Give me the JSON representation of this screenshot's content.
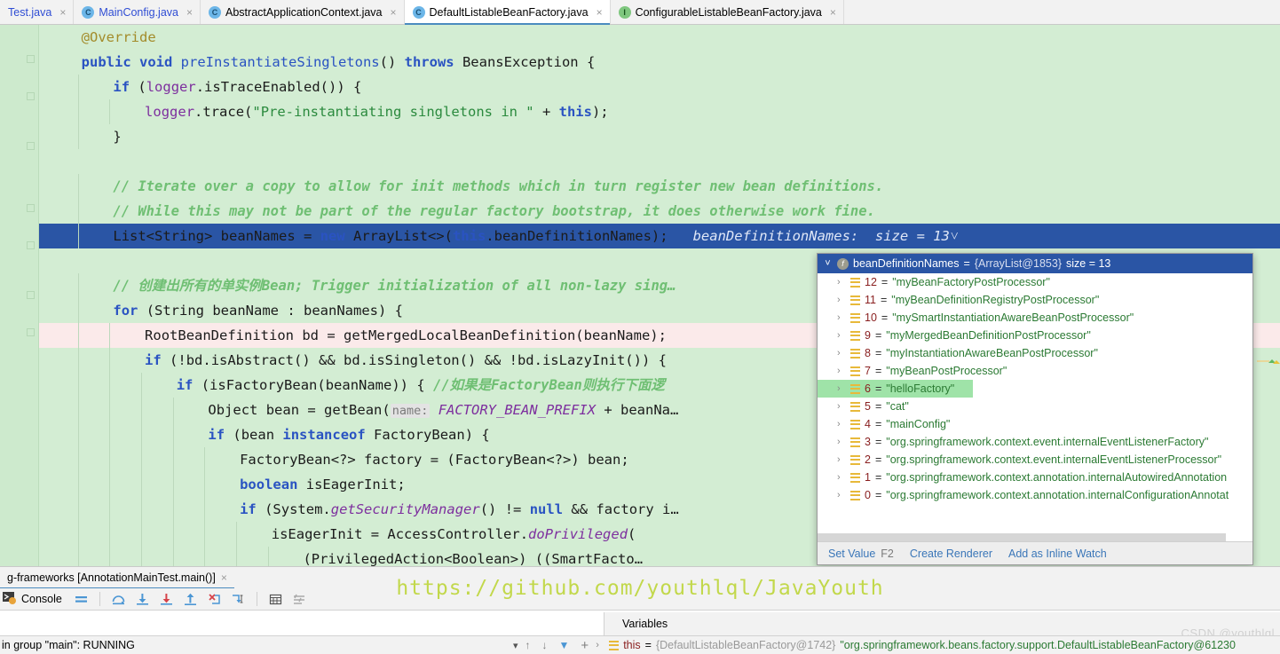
{
  "tabs": [
    {
      "label": "Test.java",
      "icon": "none",
      "active": false,
      "colored": true,
      "close": "×"
    },
    {
      "label": "MainConfig.java",
      "icon": "class-c",
      "active": false,
      "colored": true,
      "close": "×"
    },
    {
      "label": "AbstractApplicationContext.java",
      "icon": "class-c",
      "active": false,
      "colored": false,
      "close": "×"
    },
    {
      "label": "DefaultListableBeanFactory.java",
      "icon": "class-c",
      "active": true,
      "colored": false,
      "close": "×"
    },
    {
      "label": "ConfigurableListableBeanFactory.java",
      "icon": "interface-i",
      "active": false,
      "colored": false,
      "close": "×"
    }
  ],
  "editor": {
    "background": "#d3edd3",
    "highlight_line_color": "#2a55a5",
    "inline_watch": "beanDefinitionNames:  size = 13",
    "inline_watch_chevron": "˅",
    "lines": [
      {
        "tokens": [
          {
            "t": "@Override",
            "c": "ann"
          }
        ],
        "indent": 1
      },
      {
        "tokens": [
          {
            "t": "public ",
            "c": "kw"
          },
          {
            "t": "void ",
            "c": "kw"
          },
          {
            "t": "preInstantiateSingletons",
            "c": "mth"
          },
          {
            "t": "() ",
            "c": ""
          },
          {
            "t": "throws ",
            "c": "kw"
          },
          {
            "t": "BeansException {",
            "c": ""
          }
        ],
        "indent": 1
      },
      {
        "tokens": [
          {
            "t": "if ",
            "c": "kw"
          },
          {
            "t": "(",
            "c": ""
          },
          {
            "t": "logger",
            "c": "fld"
          },
          {
            "t": ".isTraceEnabled()) {",
            "c": ""
          }
        ],
        "indent": 2
      },
      {
        "tokens": [
          {
            "t": "logger",
            "c": "fld"
          },
          {
            "t": ".trace(",
            "c": ""
          },
          {
            "t": "\"Pre-instantiating singletons in \"",
            "c": "str"
          },
          {
            "t": " + ",
            "c": ""
          },
          {
            "t": "this",
            "c": "kw"
          },
          {
            "t": ");",
            "c": ""
          }
        ],
        "indent": 3
      },
      {
        "tokens": [
          {
            "t": "}",
            "c": ""
          }
        ],
        "indent": 2
      },
      {
        "tokens": [],
        "indent": 0
      },
      {
        "tokens": [
          {
            "t": "// Iterate over a copy to allow for init methods which in turn register new bean definitions.",
            "c": "cmt"
          }
        ],
        "indent": 2
      },
      {
        "tokens": [
          {
            "t": "// While this may not be part of the regular factory bootstrap, it does otherwise work fine.",
            "c": "cmt"
          }
        ],
        "indent": 2
      },
      {
        "tokens": [
          {
            "t": "List<String> beanNames = ",
            "c": ""
          },
          {
            "t": "new ",
            "c": "kw"
          },
          {
            "t": "ArrayList<>(",
            "c": ""
          },
          {
            "t": "this",
            "c": "kw"
          },
          {
            "t": ".beanDefinitionNames);",
            "c": ""
          }
        ],
        "indent": 2,
        "state": "highlight"
      },
      {
        "tokens": [],
        "indent": 0
      },
      {
        "tokens": [
          {
            "t": "// 创建出所有的单实例Bean; Trigger initialization of all non-lazy sing…",
            "c": "cmt"
          }
        ],
        "indent": 2
      },
      {
        "tokens": [
          {
            "t": "for ",
            "c": "kw"
          },
          {
            "t": "(String beanName : beanNames) {",
            "c": ""
          }
        ],
        "indent": 2
      },
      {
        "tokens": [
          {
            "t": "RootBeanDefinition bd = getMergedLocalBeanDefinition(beanName);",
            "c": ""
          }
        ],
        "indent": 3,
        "state": "pink"
      },
      {
        "tokens": [
          {
            "t": "if ",
            "c": "kw"
          },
          {
            "t": "(!bd.isAbstract() && bd.isSingleton() && !bd.isLazyInit()) {",
            "c": ""
          }
        ],
        "indent": 3
      },
      {
        "tokens": [
          {
            "t": "if ",
            "c": "kw"
          },
          {
            "t": "(isFactoryBean(beanName)) { ",
            "c": ""
          },
          {
            "t": "//如果是FactoryBean则执行下面逻",
            "c": "cmt"
          }
        ],
        "indent": 4
      },
      {
        "tokens": [
          {
            "t": "Object bean = getBean(",
            "c": ""
          },
          {
            "t": "name:",
            "c": "hint"
          },
          {
            "t": " ",
            "c": ""
          },
          {
            "t": "FACTORY_BEAN_PREFIX",
            "c": "stat"
          },
          {
            "t": " + beanNa…",
            "c": ""
          }
        ],
        "indent": 5
      },
      {
        "tokens": [
          {
            "t": "if ",
            "c": "kw"
          },
          {
            "t": "(bean ",
            "c": ""
          },
          {
            "t": "instanceof ",
            "c": "kw"
          },
          {
            "t": "FactoryBean) {",
            "c": ""
          }
        ],
        "indent": 5
      },
      {
        "tokens": [
          {
            "t": "FactoryBean<?> factory = (FactoryBean<?>) bean;",
            "c": ""
          }
        ],
        "indent": 6
      },
      {
        "tokens": [
          {
            "t": "boolean ",
            "c": "kw"
          },
          {
            "t": "isEagerInit;",
            "c": ""
          }
        ],
        "indent": 6
      },
      {
        "tokens": [
          {
            "t": "if ",
            "c": "kw"
          },
          {
            "t": "(System.",
            "c": ""
          },
          {
            "t": "getSecurityManager",
            "c": "stat"
          },
          {
            "t": "() != ",
            "c": ""
          },
          {
            "t": "null ",
            "c": "kw"
          },
          {
            "t": "&& factory i…",
            "c": ""
          }
        ],
        "indent": 6
      },
      {
        "tokens": [
          {
            "t": "isEagerInit = AccessController.",
            "c": ""
          },
          {
            "t": "doPrivileged",
            "c": "stat"
          },
          {
            "t": "(",
            "c": ""
          }
        ],
        "indent": 7
      },
      {
        "tokens": [
          {
            "t": "(PrivilegedAction<Boolean>) ((SmartFacto…",
            "c": ""
          }
        ],
        "indent": 8
      }
    ]
  },
  "popup": {
    "header": {
      "chevron": "˅",
      "icon": "field-icon",
      "name": "beanDefinitionNames",
      "equals": " = ",
      "ref": "{ArrayList@1853}",
      "size": "size = 13"
    },
    "rows": [
      {
        "arrow": "›",
        "index": "0",
        "value": "\"org.springframework.context.annotation.internalConfigurationAnnotat"
      },
      {
        "arrow": "›",
        "index": "1",
        "value": "\"org.springframework.context.annotation.internalAutowiredAnnotation"
      },
      {
        "arrow": "›",
        "index": "2",
        "value": "\"org.springframework.context.event.internalEventListenerProcessor\""
      },
      {
        "arrow": "›",
        "index": "3",
        "value": "\"org.springframework.context.event.internalEventListenerFactory\""
      },
      {
        "arrow": "›",
        "index": "4",
        "value": "\"mainConfig\""
      },
      {
        "arrow": "›",
        "index": "5",
        "value": "\"cat\""
      },
      {
        "arrow": "›",
        "index": "6",
        "value": "\"helloFactory\"",
        "selected": true
      },
      {
        "arrow": "›",
        "index": "7",
        "value": "\"myBeanPostProcessor\""
      },
      {
        "arrow": "›",
        "index": "8",
        "value": "\"myInstantiationAwareBeanPostProcessor\""
      },
      {
        "arrow": "›",
        "index": "9",
        "value": "\"myMergedBeanDefinitionPostProcessor\""
      },
      {
        "arrow": "›",
        "index": "10",
        "value": "\"mySmartInstantiationAwareBeanPostProcessor\""
      },
      {
        "arrow": "›",
        "index": "11",
        "value": "\"myBeanDefinitionRegistryPostProcessor\""
      },
      {
        "arrow": "›",
        "index": "12",
        "value": "\"myBeanFactoryPostProcessor\""
      }
    ],
    "footer": {
      "set_value": "Set Value",
      "set_value_shortcut": "F2",
      "create_renderer": "Create Renderer",
      "add_inline_watch": "Add as Inline Watch"
    }
  },
  "bottom": {
    "run_tab": "g-frameworks [AnnotationMainTest.main()]",
    "run_tab_close": "×",
    "console_label": "Console",
    "toolbar_icons": [
      "console-icon",
      "list-lines-icon",
      "step-over-icon",
      "step-into-icon",
      "force-step-into-icon",
      "step-out-icon",
      "drop-frame-icon",
      "run-to-cursor-icon",
      "evaluate-icon",
      "settings-lines-icon"
    ],
    "variables_header": "Variables",
    "thread_status": "in group \"main\": RUNNING",
    "status_dropdown": "▾",
    "status_controls": [
      "↑",
      "↓",
      "▼",
      "+"
    ],
    "variable_row": {
      "arrow": "›",
      "name": "this",
      "equals": " = ",
      "ref": "{DefaultListableBeanFactory@1742}",
      "value": "\"org.springframework.beans.factory.support.DefaultListableBeanFactory@61230"
    }
  },
  "watermarks": {
    "github_url": "https://github.com/youthlql/JavaYouth",
    "csdn": "CSDN @youthlql"
  }
}
